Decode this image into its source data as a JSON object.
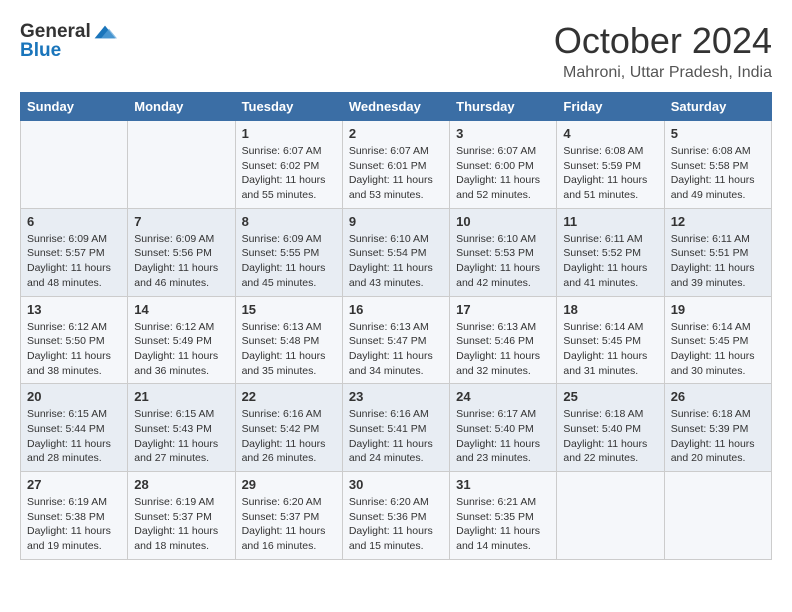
{
  "header": {
    "logo_line1": "General",
    "logo_line2": "Blue",
    "month_title": "October 2024",
    "location": "Mahroni, Uttar Pradesh, India"
  },
  "days_of_week": [
    "Sunday",
    "Monday",
    "Tuesday",
    "Wednesday",
    "Thursday",
    "Friday",
    "Saturday"
  ],
  "weeks": [
    [
      {
        "day": "",
        "info": ""
      },
      {
        "day": "",
        "info": ""
      },
      {
        "day": "1",
        "info": "Sunrise: 6:07 AM\nSunset: 6:02 PM\nDaylight: 11 hours and 55 minutes."
      },
      {
        "day": "2",
        "info": "Sunrise: 6:07 AM\nSunset: 6:01 PM\nDaylight: 11 hours and 53 minutes."
      },
      {
        "day": "3",
        "info": "Sunrise: 6:07 AM\nSunset: 6:00 PM\nDaylight: 11 hours and 52 minutes."
      },
      {
        "day": "4",
        "info": "Sunrise: 6:08 AM\nSunset: 5:59 PM\nDaylight: 11 hours and 51 minutes."
      },
      {
        "day": "5",
        "info": "Sunrise: 6:08 AM\nSunset: 5:58 PM\nDaylight: 11 hours and 49 minutes."
      }
    ],
    [
      {
        "day": "6",
        "info": "Sunrise: 6:09 AM\nSunset: 5:57 PM\nDaylight: 11 hours and 48 minutes."
      },
      {
        "day": "7",
        "info": "Sunrise: 6:09 AM\nSunset: 5:56 PM\nDaylight: 11 hours and 46 minutes."
      },
      {
        "day": "8",
        "info": "Sunrise: 6:09 AM\nSunset: 5:55 PM\nDaylight: 11 hours and 45 minutes."
      },
      {
        "day": "9",
        "info": "Sunrise: 6:10 AM\nSunset: 5:54 PM\nDaylight: 11 hours and 43 minutes."
      },
      {
        "day": "10",
        "info": "Sunrise: 6:10 AM\nSunset: 5:53 PM\nDaylight: 11 hours and 42 minutes."
      },
      {
        "day": "11",
        "info": "Sunrise: 6:11 AM\nSunset: 5:52 PM\nDaylight: 11 hours and 41 minutes."
      },
      {
        "day": "12",
        "info": "Sunrise: 6:11 AM\nSunset: 5:51 PM\nDaylight: 11 hours and 39 minutes."
      }
    ],
    [
      {
        "day": "13",
        "info": "Sunrise: 6:12 AM\nSunset: 5:50 PM\nDaylight: 11 hours and 38 minutes."
      },
      {
        "day": "14",
        "info": "Sunrise: 6:12 AM\nSunset: 5:49 PM\nDaylight: 11 hours and 36 minutes."
      },
      {
        "day": "15",
        "info": "Sunrise: 6:13 AM\nSunset: 5:48 PM\nDaylight: 11 hours and 35 minutes."
      },
      {
        "day": "16",
        "info": "Sunrise: 6:13 AM\nSunset: 5:47 PM\nDaylight: 11 hours and 34 minutes."
      },
      {
        "day": "17",
        "info": "Sunrise: 6:13 AM\nSunset: 5:46 PM\nDaylight: 11 hours and 32 minutes."
      },
      {
        "day": "18",
        "info": "Sunrise: 6:14 AM\nSunset: 5:45 PM\nDaylight: 11 hours and 31 minutes."
      },
      {
        "day": "19",
        "info": "Sunrise: 6:14 AM\nSunset: 5:45 PM\nDaylight: 11 hours and 30 minutes."
      }
    ],
    [
      {
        "day": "20",
        "info": "Sunrise: 6:15 AM\nSunset: 5:44 PM\nDaylight: 11 hours and 28 minutes."
      },
      {
        "day": "21",
        "info": "Sunrise: 6:15 AM\nSunset: 5:43 PM\nDaylight: 11 hours and 27 minutes."
      },
      {
        "day": "22",
        "info": "Sunrise: 6:16 AM\nSunset: 5:42 PM\nDaylight: 11 hours and 26 minutes."
      },
      {
        "day": "23",
        "info": "Sunrise: 6:16 AM\nSunset: 5:41 PM\nDaylight: 11 hours and 24 minutes."
      },
      {
        "day": "24",
        "info": "Sunrise: 6:17 AM\nSunset: 5:40 PM\nDaylight: 11 hours and 23 minutes."
      },
      {
        "day": "25",
        "info": "Sunrise: 6:18 AM\nSunset: 5:40 PM\nDaylight: 11 hours and 22 minutes."
      },
      {
        "day": "26",
        "info": "Sunrise: 6:18 AM\nSunset: 5:39 PM\nDaylight: 11 hours and 20 minutes."
      }
    ],
    [
      {
        "day": "27",
        "info": "Sunrise: 6:19 AM\nSunset: 5:38 PM\nDaylight: 11 hours and 19 minutes."
      },
      {
        "day": "28",
        "info": "Sunrise: 6:19 AM\nSunset: 5:37 PM\nDaylight: 11 hours and 18 minutes."
      },
      {
        "day": "29",
        "info": "Sunrise: 6:20 AM\nSunset: 5:37 PM\nDaylight: 11 hours and 16 minutes."
      },
      {
        "day": "30",
        "info": "Sunrise: 6:20 AM\nSunset: 5:36 PM\nDaylight: 11 hours and 15 minutes."
      },
      {
        "day": "31",
        "info": "Sunrise: 6:21 AM\nSunset: 5:35 PM\nDaylight: 11 hours and 14 minutes."
      },
      {
        "day": "",
        "info": ""
      },
      {
        "day": "",
        "info": ""
      }
    ]
  ]
}
